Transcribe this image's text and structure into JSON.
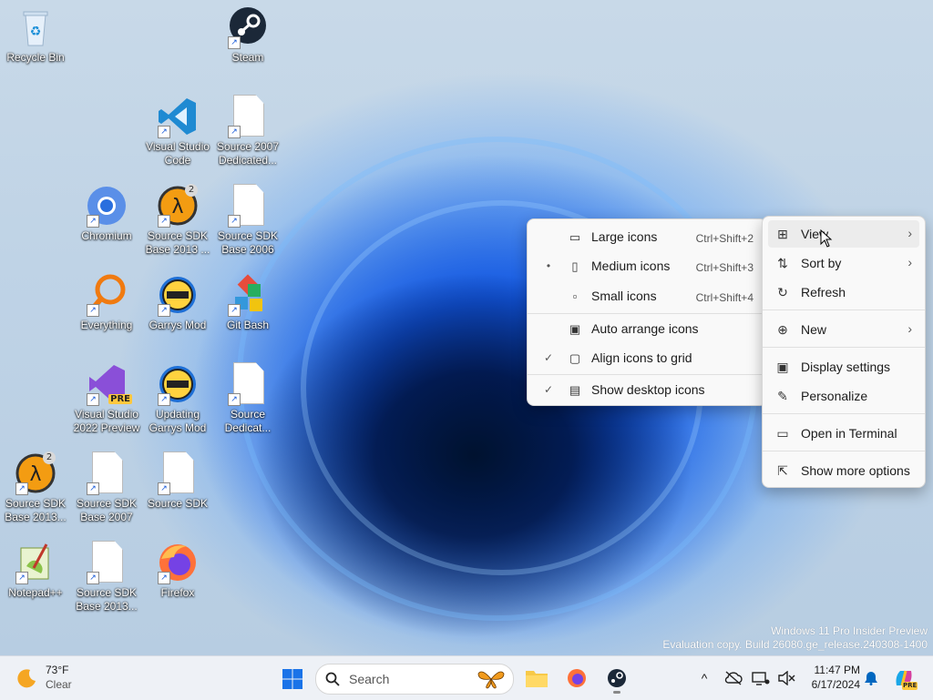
{
  "desktop": {
    "icons": [
      {
        "label": "Recycle Bin",
        "icon": "recycle-bin-icon"
      },
      {
        "label": "Steam",
        "icon": "steam-icon"
      },
      {
        "label": "Visual Studio Code",
        "icon": "vscode-icon"
      },
      {
        "label": "Source 2007 Dedicated...",
        "icon": "document-icon"
      },
      {
        "label": "Chromium",
        "icon": "chromium-icon"
      },
      {
        "label": "Source SDK Base 2013 ...",
        "icon": "half-life-icon"
      },
      {
        "label": "Source SDK Base 2006",
        "icon": "document-icon"
      },
      {
        "label": "Everything",
        "icon": "everything-icon"
      },
      {
        "label": "Garrys Mod",
        "icon": "garrys-mod-icon"
      },
      {
        "label": "Git Bash",
        "icon": "git-bash-icon"
      },
      {
        "label": "Visual Studio 2022 Preview",
        "icon": "visual-studio-icon"
      },
      {
        "label": "Updating Garrys Mod",
        "icon": "garrys-mod-icon"
      },
      {
        "label": "Source Dedicat...",
        "icon": "document-icon"
      },
      {
        "label": "Source SDK Base 2013...",
        "icon": "half-life-icon"
      },
      {
        "label": "Source SDK Base 2007",
        "icon": "document-icon"
      },
      {
        "label": "Source SDK",
        "icon": "document-icon"
      },
      {
        "label": "Notepad++",
        "icon": "notepadpp-icon"
      },
      {
        "label": "Source SDK Base 2013...",
        "icon": "document-icon"
      },
      {
        "label": "Firefox",
        "icon": "firefox-icon"
      }
    ],
    "badges": {
      "pre": "PRE",
      "hl2": "2",
      "lambda": "λ"
    }
  },
  "context_menu": {
    "items": [
      {
        "label": "View",
        "icon": "grid-icon"
      },
      {
        "label": "Sort by",
        "icon": "sort-icon"
      },
      {
        "label": "Refresh",
        "icon": "refresh-icon"
      },
      {
        "label": "New",
        "icon": "plus-circle-icon"
      },
      {
        "label": "Display settings",
        "icon": "display-icon"
      },
      {
        "label": "Personalize",
        "icon": "pen-icon"
      },
      {
        "label": "Open in Terminal",
        "icon": "terminal-icon"
      },
      {
        "label": "Show more options",
        "icon": "share-icon"
      }
    ],
    "chevron": "›"
  },
  "view_submenu": {
    "items": [
      {
        "label": "Large icons",
        "shortcut": "Ctrl+Shift+2",
        "mark": ""
      },
      {
        "label": "Medium icons",
        "shortcut": "Ctrl+Shift+3",
        "mark": "•"
      },
      {
        "label": "Small icons",
        "shortcut": "Ctrl+Shift+4",
        "mark": ""
      },
      {
        "label": "Auto arrange icons",
        "shortcut": "",
        "mark": ""
      },
      {
        "label": "Align icons to grid",
        "shortcut": "",
        "mark": "✓"
      },
      {
        "label": "Show desktop icons",
        "shortcut": "",
        "mark": "✓"
      }
    ]
  },
  "watermark": {
    "line1": "Windows 11 Pro Insider Preview",
    "line2": "Evaluation copy. Build 26080.ge_release.240308-1400"
  },
  "taskbar": {
    "weather_temp": "73°F",
    "weather_desc": "Clear",
    "search_placeholder": "Search",
    "time": "11:47 PM",
    "date": "6/17/2024",
    "tray_chevron": "^"
  },
  "colors": {
    "accent": "#0067c0",
    "menu_bg": "#f9f9f9",
    "taskbar_bg": "#eef1f6"
  }
}
